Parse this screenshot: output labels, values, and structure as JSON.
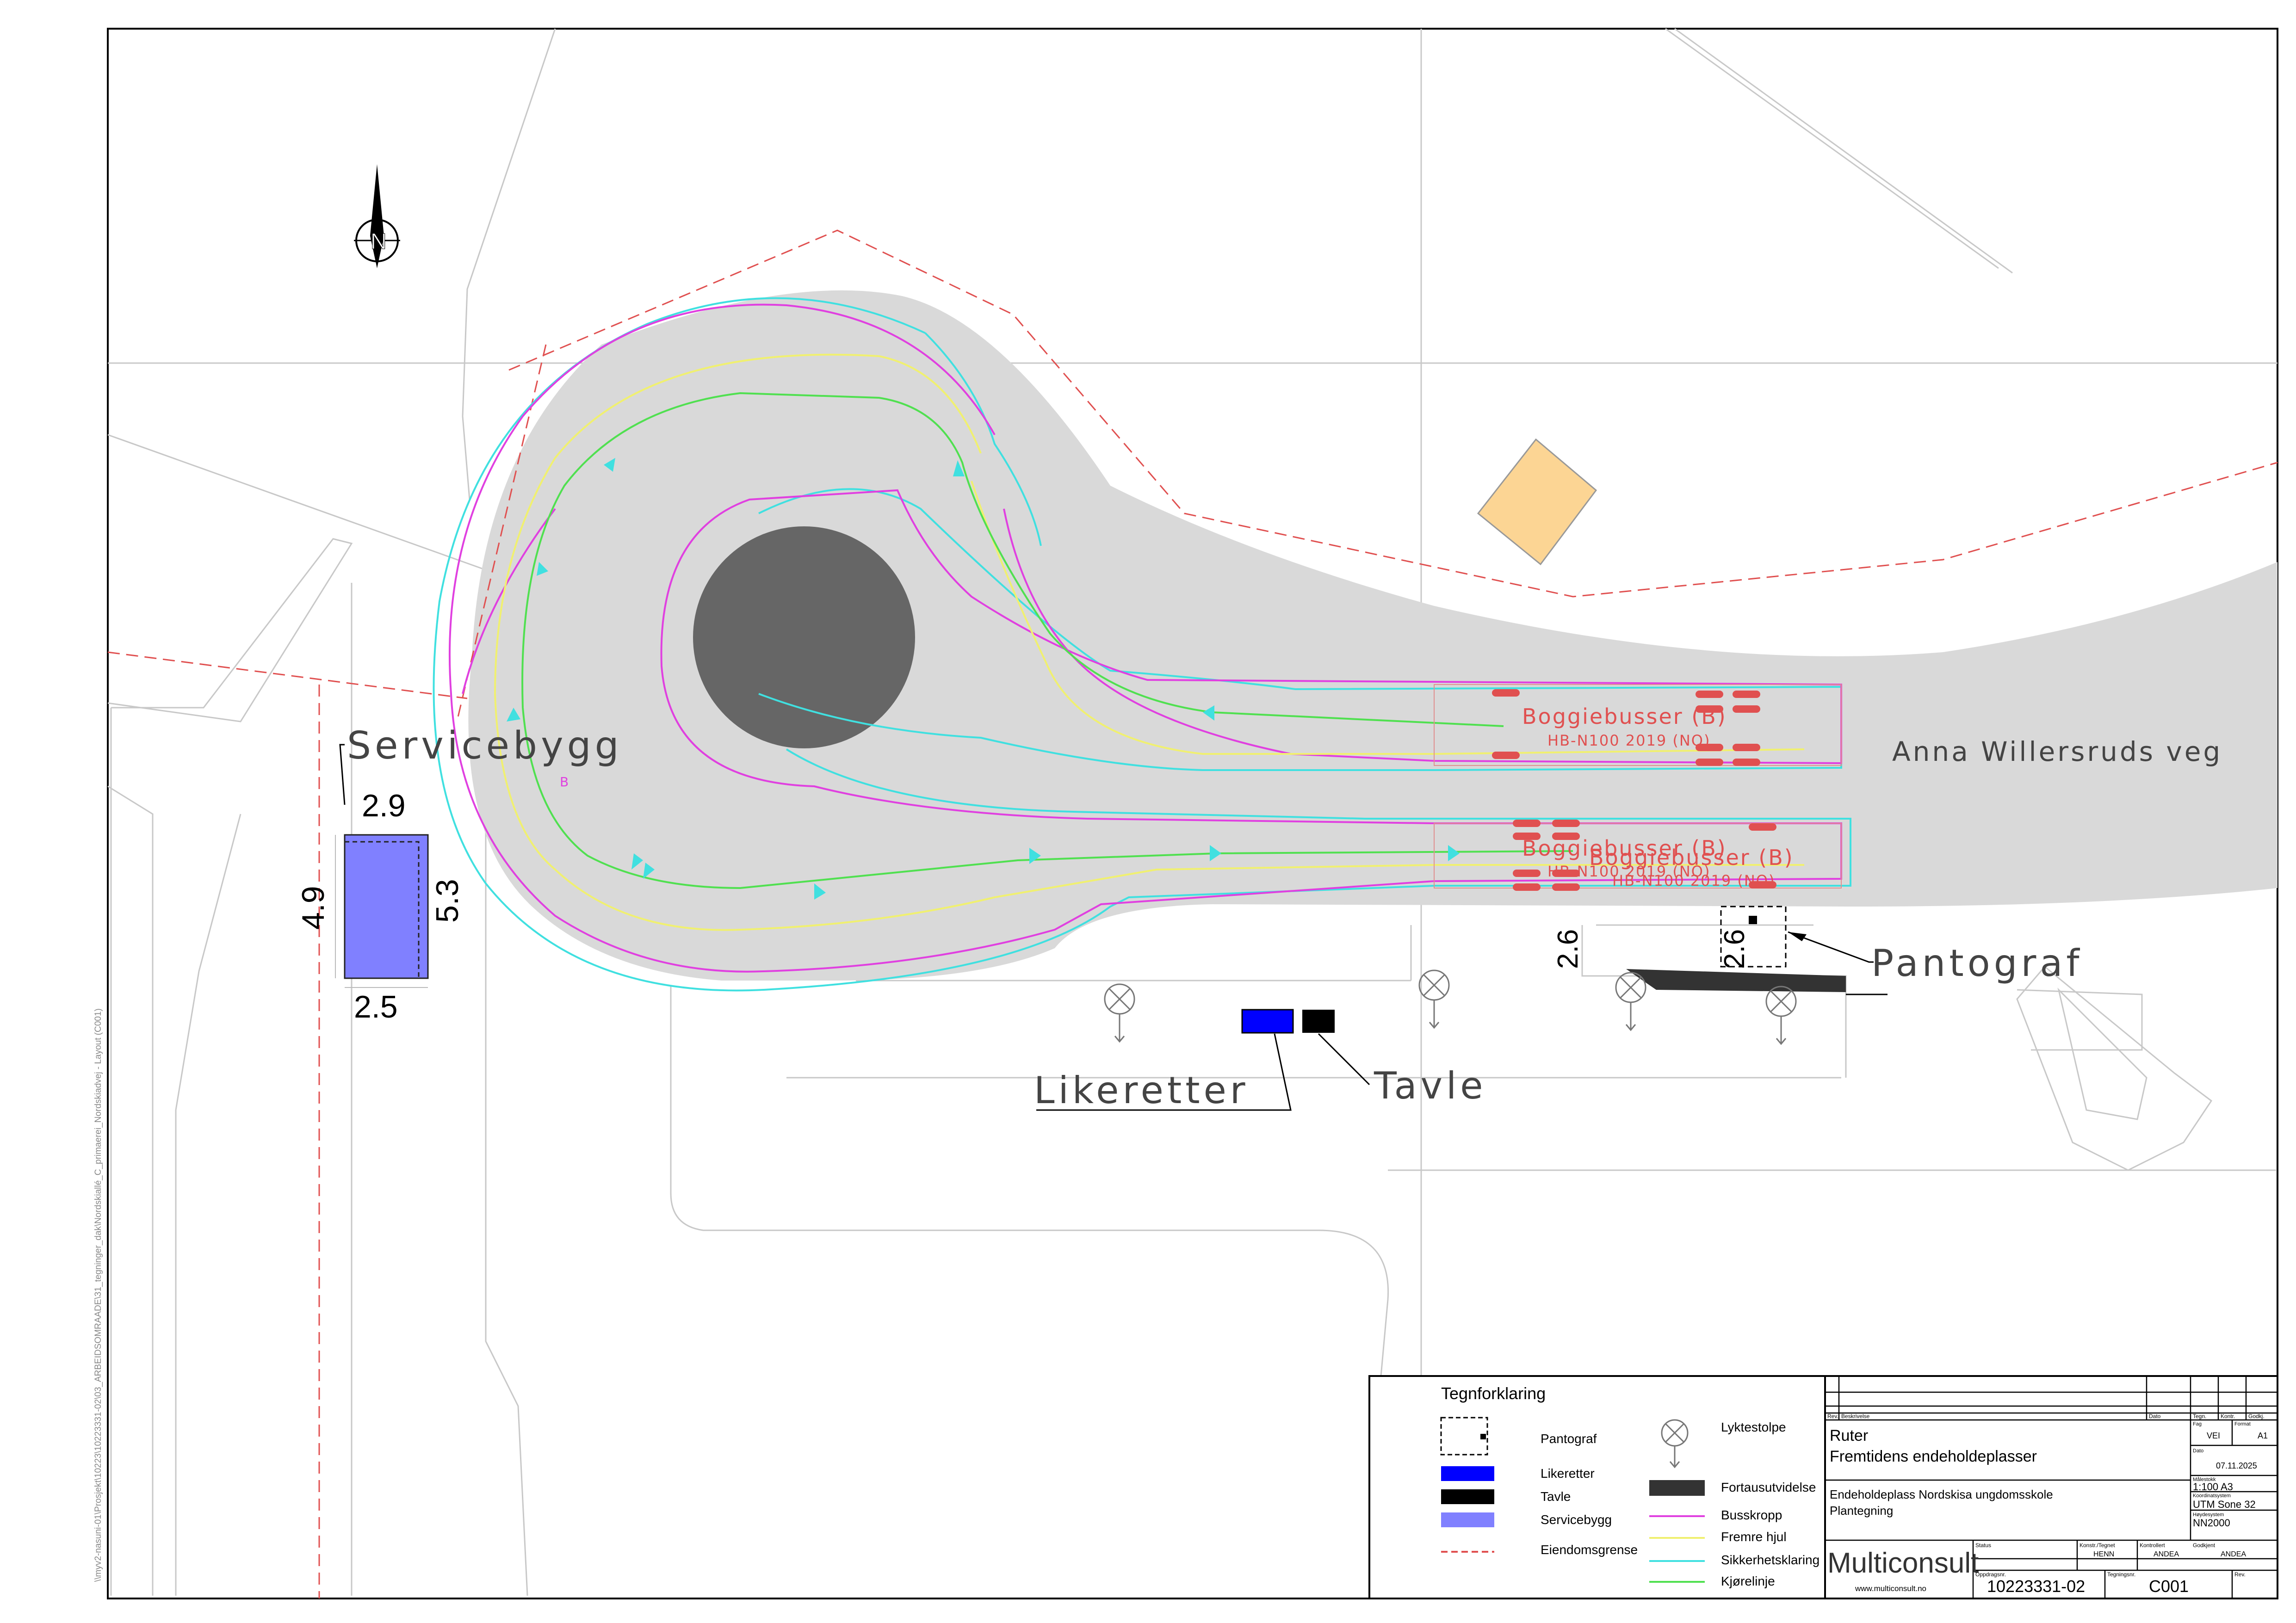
{
  "side_path": "\\\\myv2-nasuni-01\\Prosjekt\\10223\\10223331-02\\03_ARBEIDSOMRAADE\\31_tegninger_dak\\Nordskiallé_C_primaerei_Nordskiadvej - Layout (C001)",
  "labels": {
    "servicebygg": "Servicebygg",
    "likeretter": "Likeretter",
    "tavle": "Tavle",
    "pantograf": "Pantograf",
    "street": "Anna Willersruds veg",
    "bus1": "Boggiebusser (B)",
    "bus1_sub": "HB-N100 2019 (NO)",
    "bus2": "Boggiebusser (B)",
    "bus2_ghost": "Boggiebusser (B)",
    "bus2_sub": "HB-N100 2019 (NO)",
    "bus2_sub2": "HB-N100 2019 (NO)",
    "curve_tag": "B"
  },
  "dimensions": {
    "top": "2.9",
    "left": "4.9",
    "right": "5.3",
    "bottom": "2.5",
    "canopy1": "2.6",
    "canopy2": "2.6"
  },
  "north_letter": "N",
  "legend": {
    "title": "Tegnforklaring",
    "left": [
      {
        "icon": "pantograf-symbol",
        "label": "Pantograf"
      },
      {
        "icon": "blue-rect",
        "label": "Likeretter"
      },
      {
        "icon": "black-rect",
        "label": "Tavle"
      },
      {
        "icon": "light-blue-rect",
        "label": "Servicebygg"
      },
      {
        "icon": "red-dashed-line",
        "label": "Eiendomsgrense"
      }
    ],
    "right": [
      {
        "icon": "lamp-post-symbol",
        "label": "Lyktestolpe"
      },
      {
        "icon": "dark-rect",
        "label": "Fortausutvidelse"
      },
      {
        "icon": "magenta-line",
        "label": "Busskropp"
      },
      {
        "icon": "yellow-line",
        "label": "Fremre hjul"
      },
      {
        "icon": "cyan-line",
        "label": "Sikkerhetsklaring"
      },
      {
        "icon": "green-line",
        "label": "Kjørelinje"
      }
    ]
  },
  "title_block": {
    "rev": "Rev.",
    "beskrivelse": "Beskrivelse",
    "dato": "Dato",
    "tegn": "Tegn.",
    "kontr": "Kontr.",
    "godkj": "Godkj.",
    "client": "Ruter",
    "project": "Fremtidens endeholdeplasser",
    "drawing_line1": "Endeholdeplass Nordskisa ungdomsskole",
    "drawing_line2": "Plantegning",
    "fag_label": "Fag",
    "fag_value": "VEI",
    "format_label": "Format",
    "format_value": "A1",
    "dato_label": "Dato",
    "dato_value": "07.11.2025",
    "malestokk_label": "Målestokk",
    "malestokk_value": "1:100  A3",
    "koord_label": "Koordinatsystem",
    "koord_value": "UTM Sone 32",
    "hoyde_label": "Høydesystem",
    "hoyde_value": "NN2000",
    "company": "Multiconsult",
    "website": "www.multiconsult.no",
    "status_label": "Status",
    "konstr_label": "Konstr./Tegnet",
    "konstr_value": "HENN",
    "kontrollert_label": "Kontrollert",
    "kontrollert_value": "ANDEA",
    "godkjent_label": "Godkjent",
    "godkjent_value": "ANDEA",
    "oppdrag_label": "Oppdragsnr.",
    "oppdrag_value": "10223331-02",
    "tegningsnr_label": "Tegningsnr.",
    "tegningsnr_value": "C001",
    "rev_label": "Rev."
  },
  "colors": {
    "road": "#d9d9d9",
    "island": "#666666",
    "magenta": "#e040e0",
    "cyan": "#40e0e0",
    "yellow": "#f0f070",
    "green": "#50e050",
    "property": "#e05050",
    "servicebygg": "#8080ff",
    "likeretter": "#0000ff",
    "tavle": "#000000",
    "fortau": "#333333",
    "orange": "#fcd594",
    "bus_text": "#e05050"
  }
}
